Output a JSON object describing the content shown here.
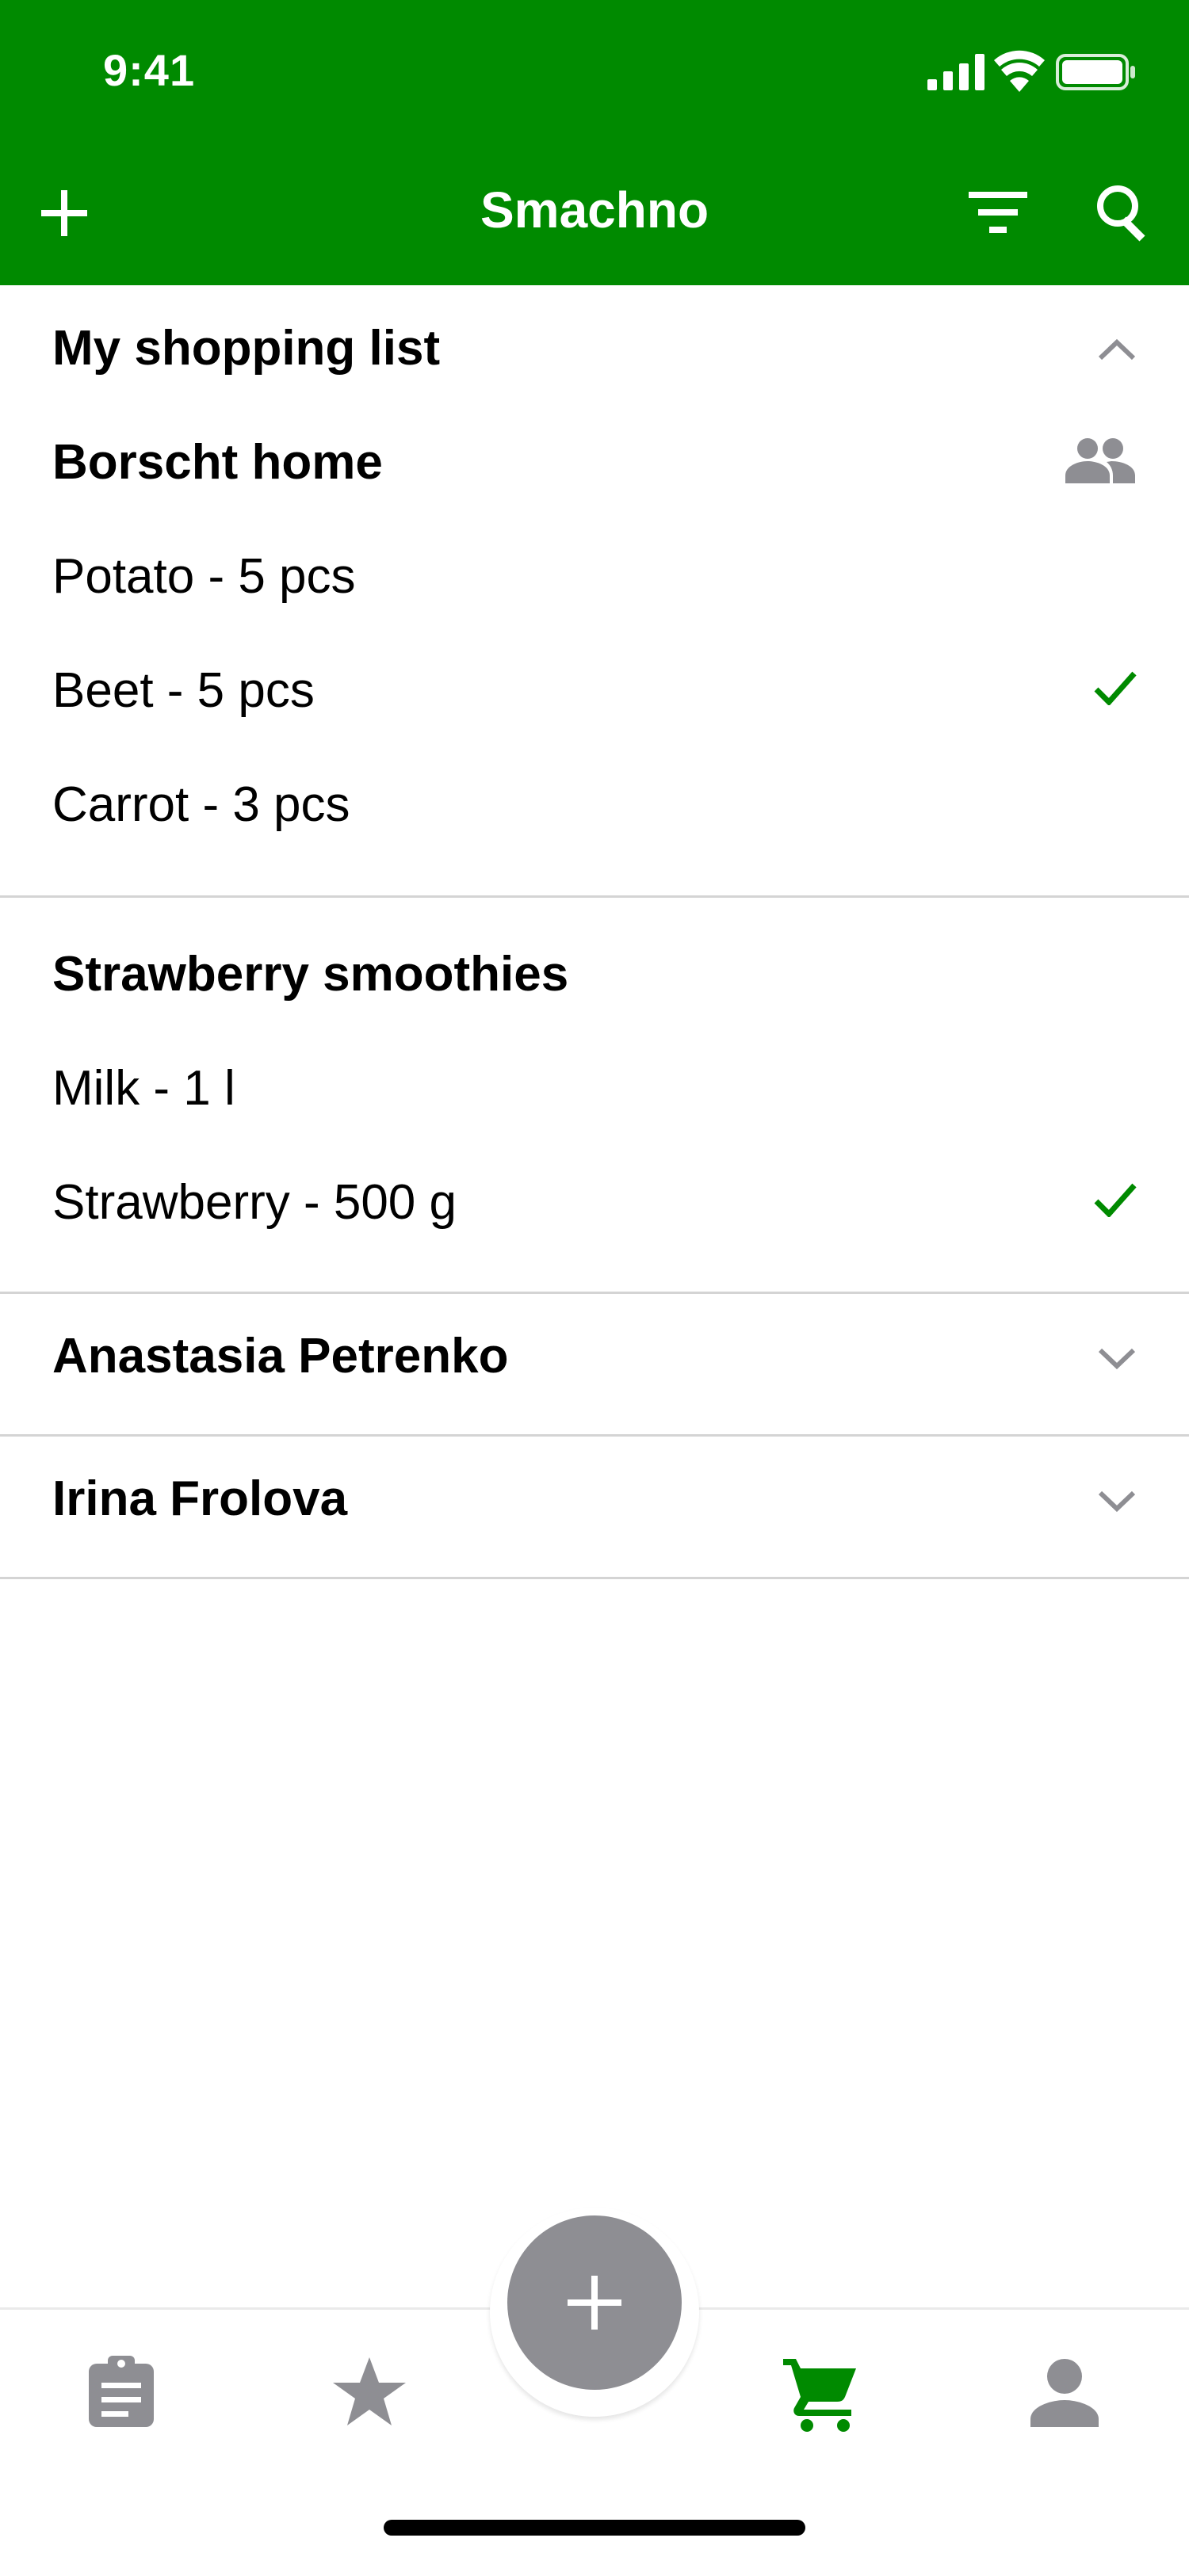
{
  "status_bar": {
    "time": "9:41"
  },
  "header": {
    "title": "Smachno",
    "accent": "#008a00"
  },
  "sections": [
    {
      "title": "My shopping list",
      "groups": [
        {
          "title": "Borscht home",
          "items": [
            {
              "label": "Potato - 5 pcs",
              "checked": false
            },
            {
              "label": "Beet - 5 pcs",
              "checked": true
            },
            {
              "label": "Carrot - 3 pcs",
              "checked": false
            }
          ]
        },
        {
          "title": "Strawberry smoothies",
          "items": [
            {
              "label": "Milk - 1 l",
              "checked": false
            },
            {
              "label": "Strawberry - 500 g",
              "checked": true
            }
          ]
        }
      ]
    },
    {
      "title": "Anastasia Petrenko"
    },
    {
      "title": "Irina Frolova"
    }
  ],
  "icons": {
    "add": "plus-icon",
    "filter": "filter-icon",
    "search": "search-icon",
    "collapse": "chevron-up-icon",
    "expand": "chevron-down-icon",
    "shared": "people-icon",
    "check": "checkmark-icon",
    "tabs": [
      "clipboard-icon",
      "star-icon",
      "plus-icon",
      "cart-icon",
      "person-icon"
    ]
  },
  "tabbar": {
    "active_index": 3,
    "active_color": "#008a00",
    "inactive_color": "#8e8e93"
  }
}
